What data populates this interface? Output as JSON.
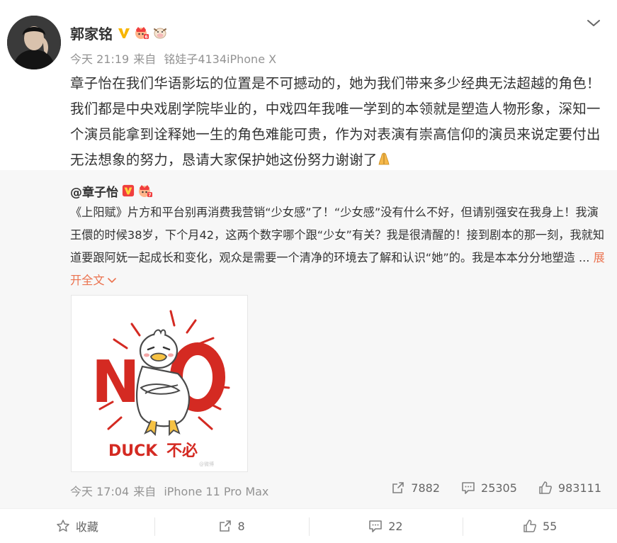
{
  "post": {
    "username": "郭家铭",
    "time": "今天 21:19",
    "source_prefix": "来自",
    "source": "铭娃子4134iPhone X",
    "text": "章子怡在我们华语影坛的位置是不可撼动的，她为我们带来多少经典无法超越的角色！我们都是中央戏剧学院毕业的，中戏四年我唯一学到的本领就是塑造人物形象，深知一个演员能拿到诠释她一生的角色难能可贵，作为对表演有崇高信仰的演员来说定要付出无法想象的努力，恳请大家保护她这份努力谢谢了",
    "emoji": "pray-emoji"
  },
  "repost": {
    "username": "@章子怡",
    "text": "《上阳赋》片方和平台别再消费我营销“少女感”了！“少女感”没有什么不好，但请别强安在我身上！我演王儇的时候38岁，下个月42，这两个数字哪个跟“少女”有关？我是很清醒的！接到剧本的那一刻，我就知道要跟阿妩一起成长和变化，观众是需要一个清净的环境去了解和认识“她”的。我是本本分分地塑造 ...",
    "expand_label": "展开全文",
    "image": {
      "title_text": "NO",
      "caption_en": "DUCK",
      "caption_cn": "不必"
    },
    "time": "今天 17:04",
    "source_prefix": "来自",
    "source": "iPhone 11 Pro Max",
    "stats": {
      "reposts": "7882",
      "comments": "25305",
      "likes": "983111"
    }
  },
  "actions": {
    "favorite": "收藏",
    "repost": "8",
    "comment": "22",
    "like": "55"
  },
  "colors": {
    "accent": "#eb7350",
    "vip_gold": "#f7b500",
    "duck_red": "#d42a22"
  }
}
